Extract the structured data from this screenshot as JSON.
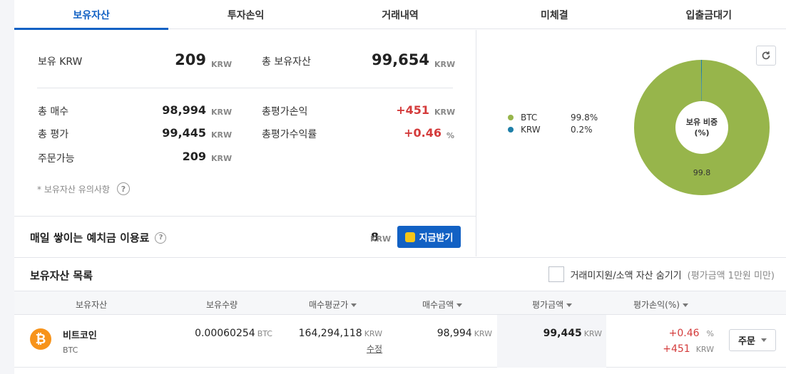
{
  "tabs": [
    {
      "label": "보유자산",
      "active": true
    },
    {
      "label": "투자손익",
      "active": false
    },
    {
      "label": "거래내역",
      "active": false
    },
    {
      "label": "미체결",
      "active": false
    },
    {
      "label": "입출금대기",
      "active": false
    }
  ],
  "summary": {
    "krw_label": "보유 KRW",
    "krw_value": "209",
    "krw_unit": "KRW",
    "total_label": "총 보유자산",
    "total_value": "99,654",
    "total_unit": "KRW",
    "buy_label": "총 매수",
    "buy_value": "98,994",
    "buy_unit": "KRW",
    "pnl_label": "총평가손익",
    "pnl_value": "+451",
    "pnl_unit": "KRW",
    "eval_label": "총 평가",
    "eval_value": "99,445",
    "eval_unit": "KRW",
    "rate_label": "총평가수익률",
    "rate_value": "+0.46",
    "rate_unit": "%",
    "avail_label": "주문가능",
    "avail_value": "209",
    "avail_unit": "KRW",
    "note": "* 보유자산 유의사항",
    "help_glyph": "?"
  },
  "chart_data": {
    "type": "pie",
    "center_label_line1": "보유 비중",
    "center_label_line2": "(%)",
    "slices": [
      {
        "label": "BTC",
        "value": 99.8,
        "display": "99.8%",
        "color": "#97b54b"
      },
      {
        "label": "KRW",
        "value": 0.2,
        "display": "0.2%",
        "color": "#1e7fa8"
      }
    ],
    "slice_label": "99.8"
  },
  "interest": {
    "title": "매일 쌓이는 예치금 이용료",
    "amount": "8",
    "unit": "KRW",
    "button_label": "지금받기"
  },
  "holdings": {
    "title": "보유자산 목록",
    "hide_label": "거래미지원/소액 자산 숨기기",
    "hide_hint": "(평가금액 1만원 미만)",
    "columns": [
      "보유자산",
      "보유수량",
      "매수평균가",
      "매수금액",
      "평가금액",
      "평가손익(%)"
    ],
    "rows": [
      {
        "name": "비트코인",
        "symbol": "BTC",
        "icon_glyph": "₿",
        "quantity": "0.00060254",
        "quantity_unit": "BTC",
        "avg_price": "164,294,118",
        "avg_price_unit": "KRW",
        "edit_label": "수정",
        "buy_amount": "98,994",
        "buy_unit": "KRW",
        "eval_amount": "99,445",
        "eval_unit": "KRW",
        "pnl_rate": "+0.46",
        "pnl_rate_unit": "%",
        "pnl_amount": "+451",
        "pnl_unit": "KRW",
        "order_label": "주문"
      }
    ]
  },
  "colors": {
    "accent": "#1261c4",
    "loss_gain_red": "#d43b3b"
  }
}
